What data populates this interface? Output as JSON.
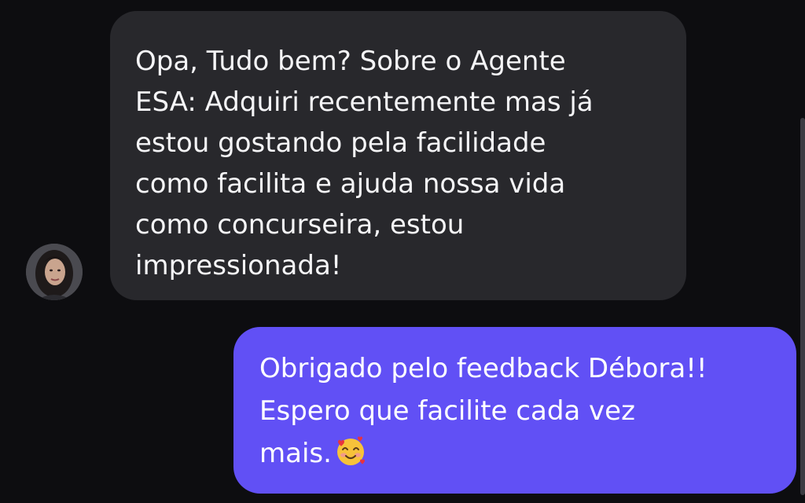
{
  "incoming_message": {
    "lines": [
      "Opa, Tudo bem? Sobre o Agente",
      "ESA: Adquiri recentemente mas já",
      "estou gostando pela facilidade",
      "como facilita e ajuda nossa vida",
      "como concurseira, estou",
      "impressionada!"
    ]
  },
  "outgoing_message": {
    "lines": [
      "Obrigado pelo feedback Débora!!",
      "Espero que facilite cada vez",
      "mais."
    ],
    "emoji": "smiling-face-with-hearts-icon"
  },
  "colors": {
    "background": "#0d0d10",
    "incoming_bubble": "#28282c",
    "outgoing_bubble": "#6150f5"
  }
}
